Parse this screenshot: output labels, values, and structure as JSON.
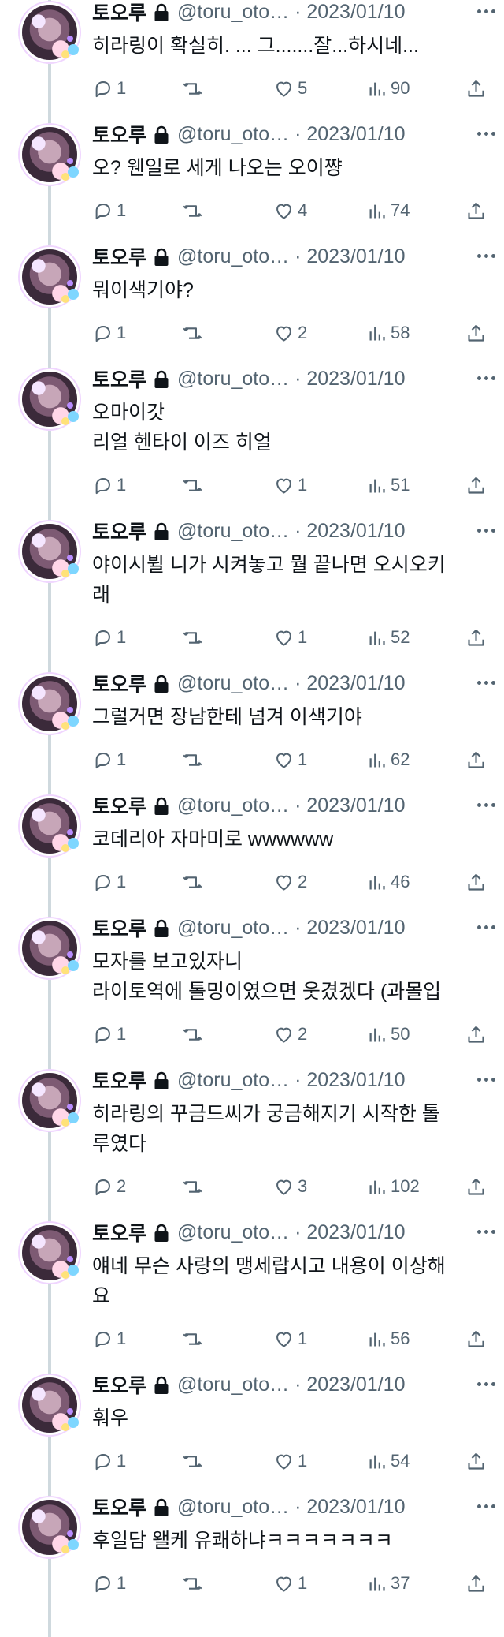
{
  "user": {
    "display_name": "토오루",
    "handle_date": "@toru_oto… · 2023/01/10"
  },
  "icons": {
    "lock": "lock-icon",
    "more": "more-icon",
    "reply": "reply-icon",
    "retweet": "retweet-icon",
    "like": "heart-icon",
    "views": "views-icon",
    "share": "share-icon"
  },
  "colors": {
    "text": "#0f1419",
    "secondary": "#536471",
    "thread_line": "#cfd9de"
  },
  "tweets": [
    {
      "lines": [
        "히라링이 확실히. ... 그.......잘...하시네..."
      ],
      "replies": "1",
      "likes": "5",
      "views": "90"
    },
    {
      "lines": [
        "오? 웬일로 세게 나오는 오이쨩"
      ],
      "replies": "1",
      "likes": "4",
      "views": "74"
    },
    {
      "lines": [
        "뭐이색기야?"
      ],
      "replies": "1",
      "likes": "2",
      "views": "58"
    },
    {
      "lines": [
        "오마이갓",
        "리얼 헨타이 이즈 히얼"
      ],
      "replies": "1",
      "likes": "1",
      "views": "51"
    },
    {
      "lines": [
        "야이시뷜 니가 시켜놓고 뭘 끝나면 오시오키",
        "래"
      ],
      "replies": "1",
      "likes": "1",
      "views": "52"
    },
    {
      "lines": [
        "그럴거면 장남한테 넘겨 이색기야"
      ],
      "replies": "1",
      "likes": "1",
      "views": "62"
    },
    {
      "lines": [
        "코데리아 자마미로 wwwwww"
      ],
      "replies": "1",
      "likes": "2",
      "views": "46"
    },
    {
      "lines": [
        "모자를 보고있자니",
        "라이토역에 톨밍이였으면 웃겼겠다 (과몰입"
      ],
      "replies": "1",
      "likes": "2",
      "views": "50"
    },
    {
      "lines": [
        "히라링의 꾸금드씨가 궁금해지기 시작한 톨",
        "루였다"
      ],
      "replies": "2",
      "likes": "3",
      "views": "102"
    },
    {
      "lines": [
        "얘네 무슨 사랑의 맹세랍시고 내용이 이상해",
        "요"
      ],
      "replies": "1",
      "likes": "1",
      "views": "56"
    },
    {
      "lines": [
        "훠우"
      ],
      "replies": "1",
      "likes": "1",
      "views": "54"
    },
    {
      "lines": [
        "후일담 왤케 유쾌하냐ㅋㅋㅋㅋㅋㅋㅋ"
      ],
      "replies": "1",
      "likes": "1",
      "views": "37"
    }
  ]
}
